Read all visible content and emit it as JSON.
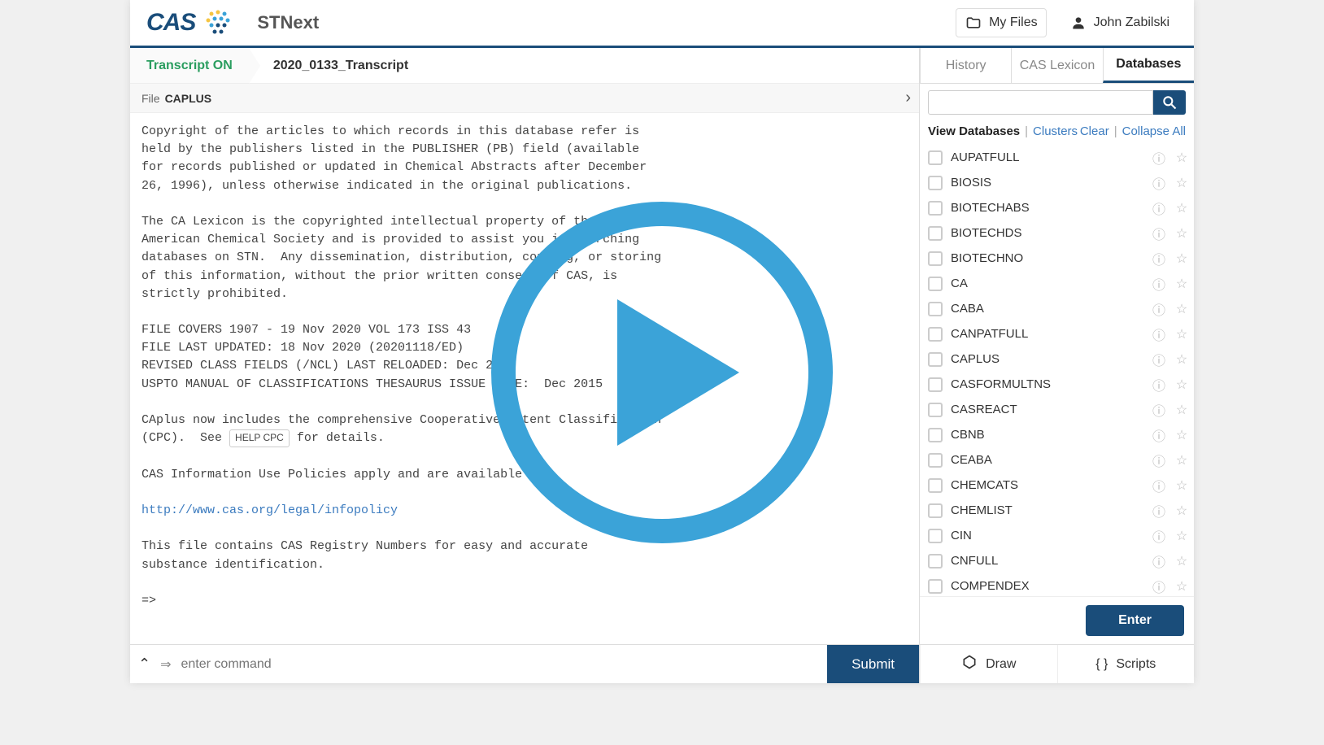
{
  "header": {
    "brand1": "CAS",
    "brand2": "STNext",
    "myfiles": "My Files",
    "user": "John Zabilski"
  },
  "crumb": {
    "on": "Transcript ON",
    "name": "2020_0133_Transcript"
  },
  "filebar": {
    "label": "File",
    "value": "CAPLUS"
  },
  "content": {
    "p1": "Copyright of the articles to which records in this database refer is\nheld by the publishers listed in the PUBLISHER (PB) field (available\nfor records published or updated in Chemical Abstracts after December\n26, 1996), unless otherwise indicated in the original publications.",
    "p2": "The CA Lexicon is the copyrighted intellectual property of the\nAmerican Chemical Society and is provided to assist you in searching\ndatabases on STN.  Any dissemination, distribution, copying, or storing\nof this information, without the prior written consent of CAS, is\nstrictly prohibited.",
    "p3": "FILE COVERS 1907 - 19 Nov 2020 VOL 173 ISS 43\nFILE LAST UPDATED: 18 Nov 2020 (20201118/ED)\nREVISED CLASS FIELDS (/NCL) LAST RELOADED: Dec 2015\nUSPTO MANUAL OF CLASSIFICATIONS THESAURUS ISSUE DATE:  Dec 2015",
    "p4a": "CAplus now includes the comprehensive Cooperative Patent Classification\n(CPC).  See ",
    "help": "HELP CPC",
    "p4b": " for details.",
    "p5": "CAS Information Use Policies apply and are available at",
    "link": "http://www.cas.org/legal/infopolicy",
    "p6": "This file contains CAS Registry Numbers for easy and accurate\nsubstance identification.",
    "prompt": "=>"
  },
  "cmd": {
    "placeholder": "enter command",
    "submit": "Submit"
  },
  "tabs": {
    "history": "History",
    "lexicon": "CAS Lexicon",
    "databases": "Databases"
  },
  "view": {
    "vd": "View Databases",
    "clusters": "Clusters",
    "clear": "Clear",
    "collapse": "Collapse All"
  },
  "dbs": [
    "AUPATFULL",
    "BIOSIS",
    "BIOTECHABS",
    "BIOTECHDS",
    "BIOTECHNO",
    "CA",
    "CABA",
    "CANPATFULL",
    "CAPLUS",
    "CASFORMULTNS",
    "CASREACT",
    "CBNB",
    "CEABA",
    "CHEMCATS",
    "CHEMLIST",
    "CIN",
    "CNFULL",
    "COMPENDEX"
  ],
  "enter": "Enter",
  "bottom": {
    "draw": "Draw",
    "scripts": "Scripts"
  }
}
